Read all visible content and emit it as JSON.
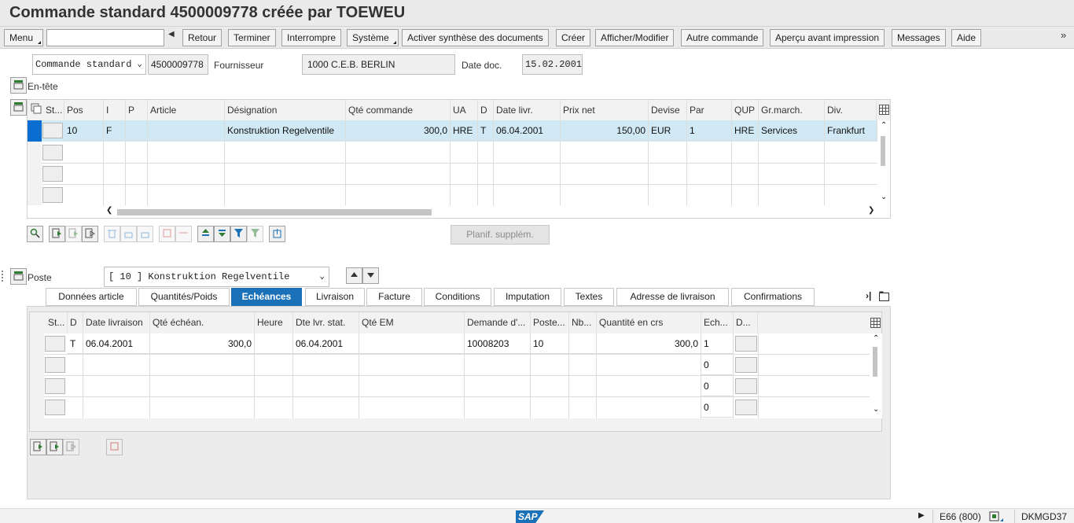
{
  "title": "Commande standard 4500009778 créée par TOEWEU",
  "toolbar": {
    "menu": "Menu",
    "retour": "Retour",
    "terminer": "Terminer",
    "interrompre": "Interrompre",
    "systeme": "Système",
    "activer": "Activer synthèse des documents",
    "creer": "Créer",
    "afficher": "Afficher/Modifier",
    "autre": "Autre commande",
    "apercu": "Aperçu avant impression",
    "messages": "Messages",
    "aide": "Aide"
  },
  "header": {
    "doc_type": "Commande standard",
    "doc_number": "4500009778",
    "supplier_label": "Fournisseur",
    "supplier_value": "1000 C.E.B. BERLIN",
    "date_label": "Date doc.",
    "date_value": "15.02.2001",
    "entete_label": "En-tête"
  },
  "items_table": {
    "columns": [
      "St...",
      "Pos",
      "I",
      "P",
      "Article",
      "Désignation",
      "Qté commande",
      "UA",
      "D",
      "Date livr.",
      "Prix net",
      "Devise",
      "Par",
      "QUP",
      "Gr.march.",
      "Div."
    ],
    "row": {
      "pos": "10",
      "i": "F",
      "designation": "Konstruktion Regelventile",
      "qty": "300,0",
      "ua": "HRE",
      "d": "T",
      "date": "06.04.2001",
      "price": "150,00",
      "devise": "EUR",
      "par": "1",
      "qup": "HRE",
      "grmarch": "Services",
      "div": "Frankfurt"
    }
  },
  "planif_button": "Planif. supplém.",
  "poste": {
    "label": "Poste",
    "value": "[ 10 ] Konstruktion Regelventile"
  },
  "tabs": [
    "Données article",
    "Quantités/Poids",
    "Echéances",
    "Livraison",
    "Facture",
    "Conditions",
    "Imputation",
    "Textes",
    "Adresse de livraison",
    "Confirmations"
  ],
  "sched_table": {
    "columns": [
      "St...",
      "D",
      "Date livraison",
      "Qté échéan.",
      "Heure",
      "Dte lvr. stat.",
      "Qté EM",
      "Demande d'...",
      "Poste...",
      "Nb...",
      "Quantité en crs",
      "Ech...",
      "D..."
    ],
    "row": {
      "d": "T",
      "date": "06.04.2001",
      "qty": "300,0",
      "stat": "06.04.2001",
      "demande": "10008203",
      "poste": "10",
      "crs": "300,0",
      "ech": "1"
    },
    "empty_ech": [
      "0",
      "0",
      "0"
    ]
  },
  "status": {
    "sap": "SAP",
    "system": "E66 (800)",
    "server": "DKMGD37"
  }
}
